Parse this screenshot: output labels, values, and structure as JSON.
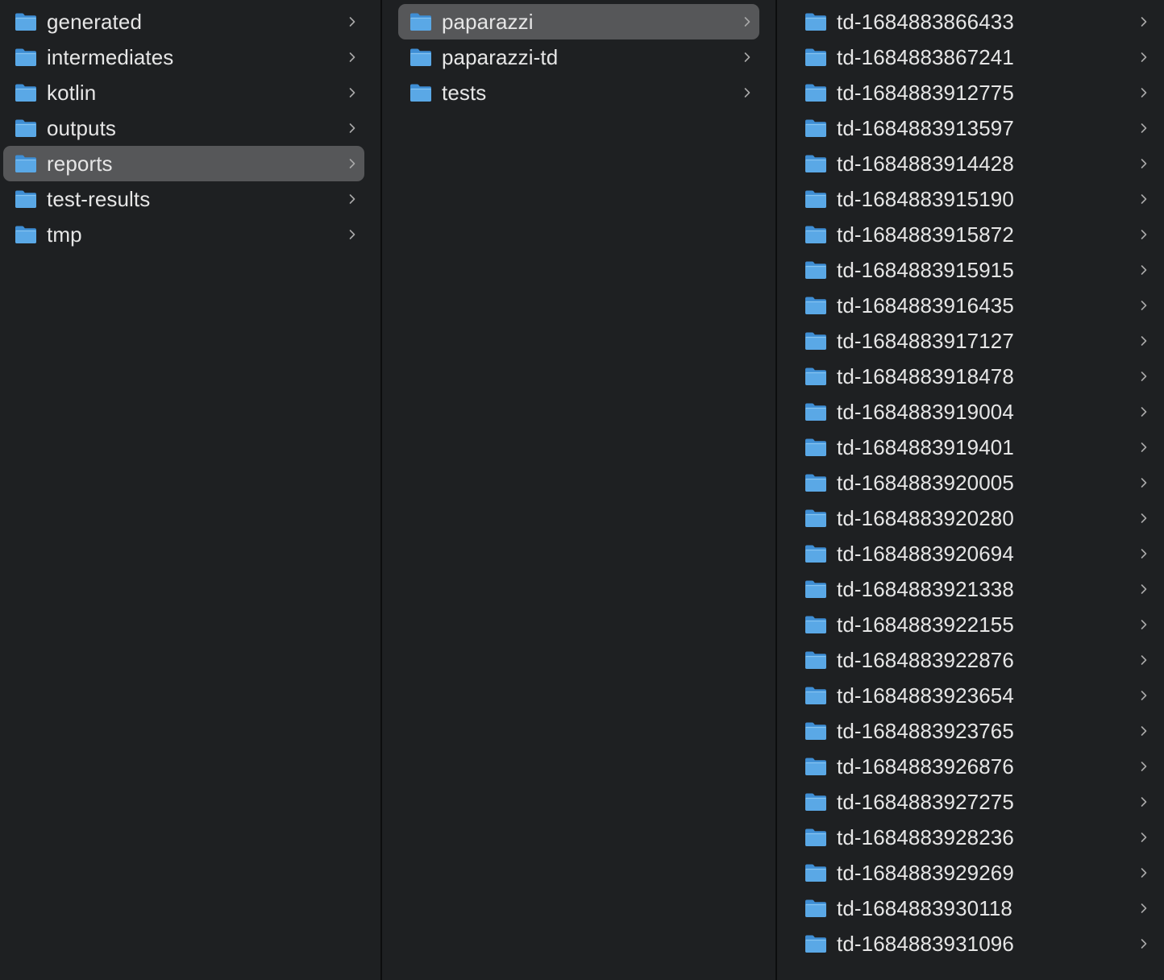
{
  "columns": [
    {
      "items": [
        {
          "label": "generated",
          "selected": false
        },
        {
          "label": "intermediates",
          "selected": false
        },
        {
          "label": "kotlin",
          "selected": false
        },
        {
          "label": "outputs",
          "selected": false
        },
        {
          "label": "reports",
          "selected": true
        },
        {
          "label": "test-results",
          "selected": false
        },
        {
          "label": "tmp",
          "selected": false
        }
      ]
    },
    {
      "items": [
        {
          "label": "paparazzi",
          "selected": true
        },
        {
          "label": "paparazzi-td",
          "selected": false
        },
        {
          "label": "tests",
          "selected": false
        }
      ]
    },
    {
      "items": [
        {
          "label": "td-1684883866433",
          "selected": false
        },
        {
          "label": "td-1684883867241",
          "selected": false
        },
        {
          "label": "td-1684883912775",
          "selected": false
        },
        {
          "label": "td-1684883913597",
          "selected": false
        },
        {
          "label": "td-1684883914428",
          "selected": false
        },
        {
          "label": "td-1684883915190",
          "selected": false
        },
        {
          "label": "td-1684883915872",
          "selected": false
        },
        {
          "label": "td-1684883915915",
          "selected": false
        },
        {
          "label": "td-1684883916435",
          "selected": false
        },
        {
          "label": "td-1684883917127",
          "selected": false
        },
        {
          "label": "td-1684883918478",
          "selected": false
        },
        {
          "label": "td-1684883919004",
          "selected": false
        },
        {
          "label": "td-1684883919401",
          "selected": false
        },
        {
          "label": "td-1684883920005",
          "selected": false
        },
        {
          "label": "td-1684883920280",
          "selected": false
        },
        {
          "label": "td-1684883920694",
          "selected": false
        },
        {
          "label": "td-1684883921338",
          "selected": false
        },
        {
          "label": "td-1684883922155",
          "selected": false
        },
        {
          "label": "td-1684883922876",
          "selected": false
        },
        {
          "label": "td-1684883923654",
          "selected": false
        },
        {
          "label": "td-1684883923765",
          "selected": false
        },
        {
          "label": "td-1684883926876",
          "selected": false
        },
        {
          "label": "td-1684883927275",
          "selected": false
        },
        {
          "label": "td-1684883928236",
          "selected": false
        },
        {
          "label": "td-1684883929269",
          "selected": false
        },
        {
          "label": "td-1684883930118",
          "selected": false
        },
        {
          "label": "td-1684883931096",
          "selected": false
        }
      ]
    }
  ],
  "icons": {
    "item_icon": "folder-icon",
    "disclosure_icon": "chevron-right-icon"
  },
  "colors": {
    "background": "#1e2022",
    "selection": "#565759",
    "text": "#e6e6e6",
    "folder": "#5aa8e6"
  }
}
